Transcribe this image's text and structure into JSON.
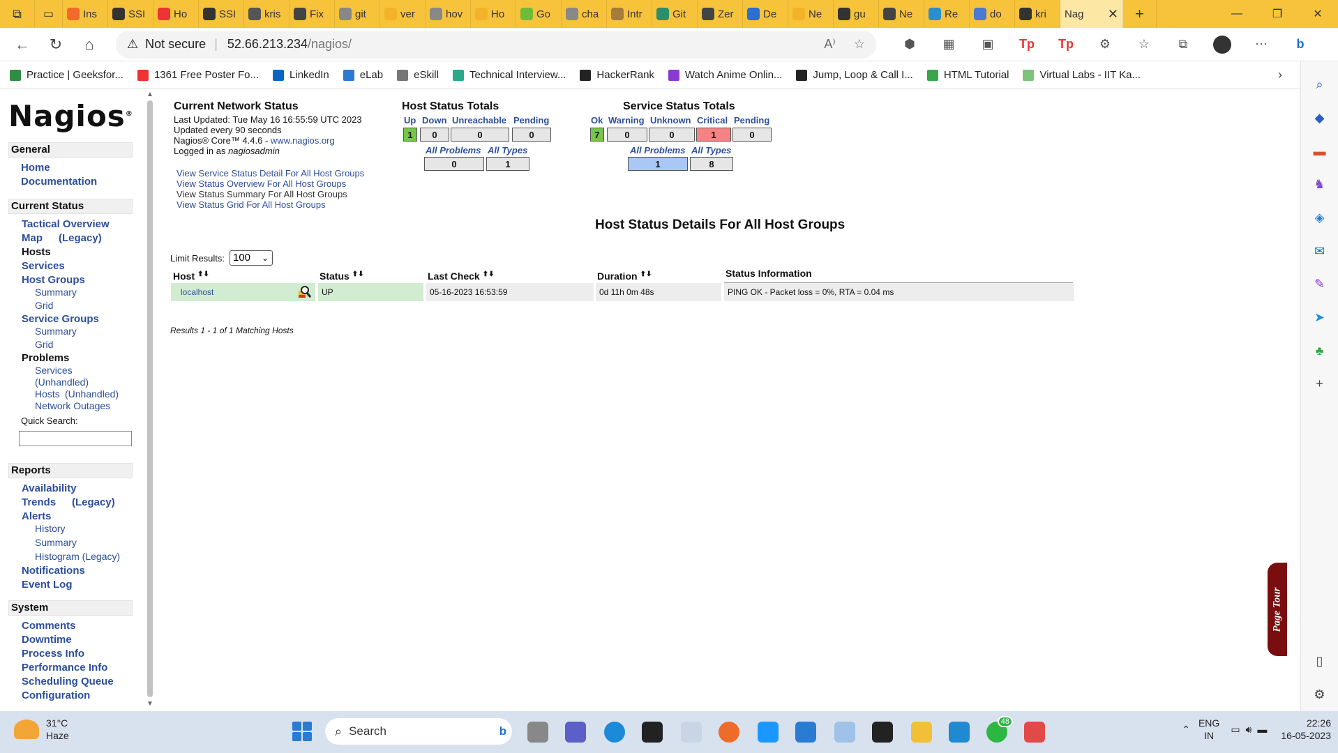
{
  "browser": {
    "tabs": [
      "Ins",
      "SSI",
      "Ho",
      "SSI",
      "kris",
      "Fix",
      "git",
      "ver",
      "hov",
      "Ho",
      "Go",
      "cha",
      "Intr",
      "Git",
      "Zer",
      "De",
      "Ne",
      "gu",
      "Ne",
      "Re",
      "do",
      "kri"
    ],
    "active_tab": "Nag",
    "not_secure": "Not secure",
    "url_host": "52.66.213.234",
    "url_path": "/nagios/",
    "bookmarks": [
      "Practice | Geeksfor...",
      "1361 Free Poster Fo...",
      "LinkedIn",
      "eLab",
      "eSkill",
      "Technical Interview...",
      "HackerRank",
      "Watch Anime Onlin...",
      "Jump, Loop & Call I...",
      "HTML Tutorial",
      "Virtual Labs - IIT Ka..."
    ]
  },
  "nav": {
    "logo": "Nagios",
    "logo_mark": "®",
    "general": {
      "heading": "General",
      "home": "Home",
      "documentation": "Documentation"
    },
    "current_status": {
      "heading": "Current Status",
      "tactical": "Tactical Overview",
      "map": "Map",
      "map_legacy": "(Legacy)",
      "hosts": "Hosts",
      "services": "Services",
      "host_groups": "Host Groups",
      "hg_summary": "Summary",
      "hg_grid": "Grid",
      "service_groups": "Service Groups",
      "sg_summary": "Summary",
      "sg_grid": "Grid",
      "problems": "Problems",
      "p_services": "Services",
      "p_unhandled": "(Unhandled)",
      "p_hosts": "Hosts",
      "p_hosts_unhandled": "(Unhandled)",
      "p_outages": "Network Outages",
      "quick_search": "Quick Search:"
    },
    "reports": {
      "heading": "Reports",
      "availability": "Availability",
      "trends": "Trends",
      "trends_legacy": "(Legacy)",
      "alerts": "Alerts",
      "history": "History",
      "summary": "Summary",
      "histogram": "Histogram (Legacy)",
      "notifications": "Notifications",
      "event_log": "Event Log"
    },
    "system": {
      "heading": "System",
      "comments": "Comments",
      "downtime": "Downtime",
      "process_info": "Process Info",
      "performance_info": "Performance Info",
      "scheduling_queue": "Scheduling Queue",
      "configuration": "Configuration"
    }
  },
  "status": {
    "title": "Current Network Status",
    "last_updated": "Last Updated: Tue May 16 16:55:59 UTC 2023",
    "update_interval": "Updated every 90 seconds",
    "core_version": "Nagios® Core™ 4.4.6 - ",
    "core_link": "www.nagios.org",
    "logged_in_prefix": "Logged in as ",
    "logged_in_user": "nagiosadmin",
    "links": [
      "View Service Status Detail For All Host Groups",
      "View Status Overview For All Host Groups",
      "View Status Summary For All Host Groups",
      "View Status Grid For All Host Groups"
    ]
  },
  "host_totals": {
    "title": "Host Status Totals",
    "labels": {
      "up": "Up",
      "down": "Down",
      "unreachable": "Unreachable",
      "pending": "Pending",
      "all_problems": "All Problems",
      "all_types": "All Types"
    },
    "values": {
      "up": "1",
      "down": "0",
      "unreachable": "0",
      "pending": "0",
      "all_problems": "0",
      "all_types": "1"
    }
  },
  "service_totals": {
    "title": "Service Status Totals",
    "labels": {
      "ok": "Ok",
      "warning": "Warning",
      "unknown": "Unknown",
      "critical": "Critical",
      "pending": "Pending",
      "all_problems": "All Problems",
      "all_types": "All Types"
    },
    "values": {
      "ok": "7",
      "warning": "0",
      "unknown": "0",
      "critical": "1",
      "pending": "0",
      "all_problems": "1",
      "all_types": "8"
    }
  },
  "details": {
    "title": "Host Status Details For All Host Groups",
    "limit_label": "Limit Results:",
    "limit_value": "100",
    "columns": {
      "host": "Host",
      "status": "Status",
      "last_check": "Last Check",
      "duration": "Duration",
      "info": "Status Information"
    },
    "rows": [
      {
        "host": "localhost",
        "status": "UP",
        "last_check": "05-16-2023 16:53:59",
        "duration": "0d 11h 0m 48s",
        "info": "PING OK - Packet loss = 0%, RTA = 0.04 ms"
      }
    ],
    "results": "Results 1 - 1 of 1 Matching Hosts"
  },
  "page_tour": "Page Tour",
  "taskbar": {
    "temp": "31°C",
    "weather": "Haze",
    "search": "Search",
    "whatsapp_badge": "48",
    "lang1": "ENG",
    "lang2": "IN",
    "time": "22:26",
    "date": "16-05-2023"
  },
  "colors": {
    "tabbar": "#f6c33b",
    "link": "#2d4e9c",
    "up_green": "#77c54a",
    "critical_red": "#f48383",
    "problem_blue": "#a9c8f5",
    "row_green": "#d1ecd0",
    "tour": "#7a0d0d"
  }
}
